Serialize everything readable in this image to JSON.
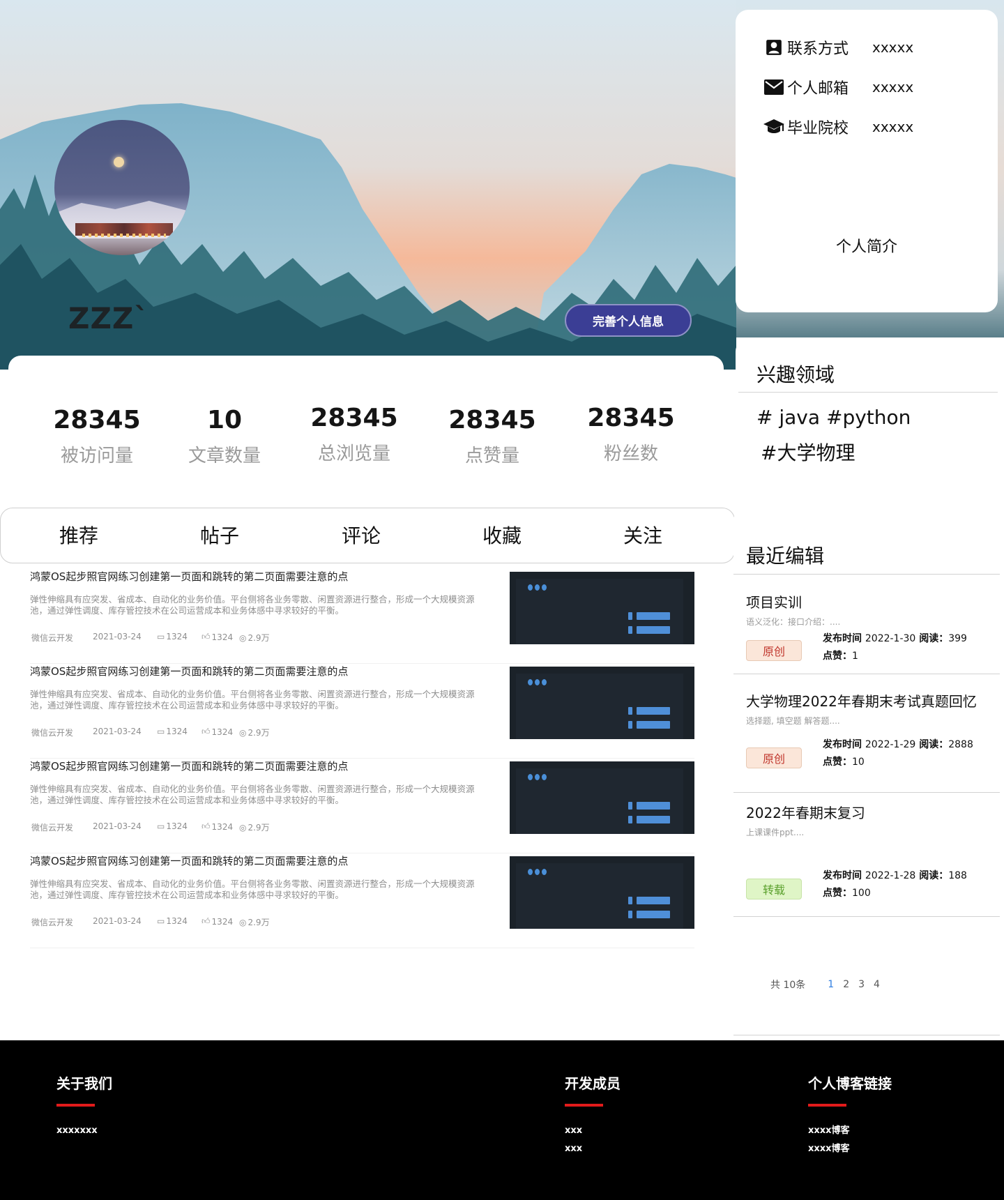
{
  "profile": {
    "username": "ZZZ`",
    "complete_button": "完善个人信息"
  },
  "stats": [
    {
      "value": "28345",
      "label": "被访问量"
    },
    {
      "value": "10",
      "label": "文章数量"
    },
    {
      "value": "28345",
      "label": "总浏览量"
    },
    {
      "value": "28345",
      "label": "点赞量"
    },
    {
      "value": "28345",
      "label": "粉丝数"
    }
  ],
  "contact": {
    "rows": [
      {
        "icon": "contact-card-icon",
        "label": "联系方式",
        "value": "xxxxx"
      },
      {
        "icon": "mail-icon",
        "label": "个人邮箱",
        "value": "xxxxx"
      },
      {
        "icon": "graduation-cap-icon",
        "label": "毕业院校",
        "value": "xxxxx"
      }
    ],
    "bio_label": "个人简介"
  },
  "interests": {
    "title": "兴趣领域",
    "tags": [
      "# java",
      "#python",
      "#大学物理"
    ]
  },
  "tabs": [
    "推荐",
    "帖子",
    "评论",
    "收藏",
    "关注"
  ],
  "articles": [
    {
      "title": "鸿蒙OS起步照官网练习创建第一页面和跳转的第二页面需要注意的点",
      "desc": "弹性伸缩具有应突发、省成本、自动化的业务价值。平台侧将各业务零散、闲置资源进行整合，形成一个大规模资源池，通过弹性调度、库存管控技术在公司运营成本和业务体感中寻求较好的平衡。",
      "source": "微信云开发",
      "date": "2021-03-24",
      "comments": "1324",
      "likes": "1324",
      "views": "2.9万"
    },
    {
      "title": "鸿蒙OS起步照官网练习创建第一页面和跳转的第二页面需要注意的点",
      "desc": "弹性伸缩具有应突发、省成本、自动化的业务价值。平台侧将各业务零散、闲置资源进行整合，形成一个大规模资源池，通过弹性调度、库存管控技术在公司运营成本和业务体感中寻求较好的平衡。",
      "source": "微信云开发",
      "date": "2021-03-24",
      "comments": "1324",
      "likes": "1324",
      "views": "2.9万"
    },
    {
      "title": "鸿蒙OS起步照官网练习创建第一页面和跳转的第二页面需要注意的点",
      "desc": "弹性伸缩具有应突发、省成本、自动化的业务价值。平台侧将各业务零散、闲置资源进行整合，形成一个大规模资源池，通过弹性调度、库存管控技术在公司运营成本和业务体感中寻求较好的平衡。",
      "source": "微信云开发",
      "date": "2021-03-24",
      "comments": "1324",
      "likes": "1324",
      "views": "2.9万"
    },
    {
      "title": "鸿蒙OS起步照官网练习创建第一页面和跳转的第二页面需要注意的点",
      "desc": "弹性伸缩具有应突发、省成本、自动化的业务价值。平台侧将各业务零散、闲置资源进行整合，形成一个大规模资源池，通过弹性调度、库存管控技术在公司运营成本和业务体感中寻求较好的平衡。",
      "source": "微信云开发",
      "date": "2021-03-24",
      "comments": "1324",
      "likes": "1324",
      "views": "2.9万"
    }
  ],
  "recent": {
    "title": "最近编辑",
    "items": [
      {
        "title": "项目实训",
        "summary": "语义泛化：接口介绍：....",
        "badge": "原创",
        "publish_label": "发布时间",
        "publish": "2022-1-30",
        "read_label": "阅读：",
        "reads": "399",
        "like_label": "点赞：",
        "likes": "1"
      },
      {
        "title": "大学物理2022年春期末考试真题回忆",
        "summary": "选择题, 填空题 解答题....",
        "badge": "原创",
        "publish_label": "发布时间",
        "publish": "2022-1-29",
        "read_label": "阅读：",
        "reads": "2888",
        "like_label": "点赞：",
        "likes": "10"
      },
      {
        "title": "2022年春期末复习",
        "summary": "上课课件ppt....",
        "badge": "转载",
        "publish_label": "发布时间",
        "publish": "2022-1-28",
        "read_label": "阅读：",
        "reads": "188",
        "like_label": "点赞：",
        "likes": "100"
      }
    ],
    "pager": {
      "total": "共 10条",
      "pages": [
        "1",
        "2",
        "3",
        "4"
      ],
      "current": "1"
    }
  },
  "footer": {
    "columns": [
      {
        "title": "关于我们",
        "links": [
          "xxxxxxx"
        ]
      },
      {
        "title": "开发成员",
        "links": [
          "xxx",
          "xxx"
        ]
      },
      {
        "title": "个人博客链接",
        "links": [
          "xxxx博客",
          "xxxx博客"
        ]
      }
    ]
  },
  "colors": {
    "accent_button": "#3b3e95",
    "footer_bg": "#000000",
    "footer_accent": "#e21b1b",
    "badge_original": "#c0362c",
    "badge_repost": "#5aa02c",
    "pager_active": "#2e7de1"
  }
}
